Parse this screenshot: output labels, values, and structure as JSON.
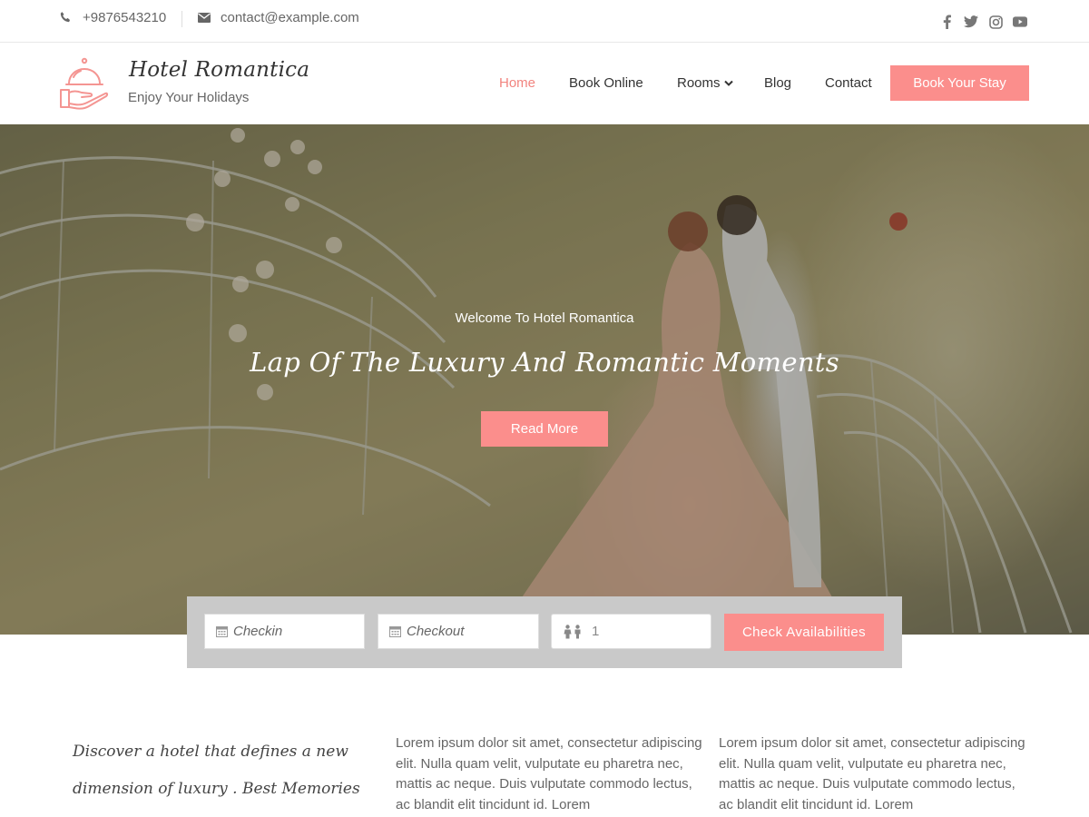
{
  "topbar": {
    "phone": "+9876543210",
    "email": "contact@example.com",
    "social": [
      "facebook-icon",
      "twitter-icon",
      "instagram-icon",
      "youtube-icon"
    ]
  },
  "brand": {
    "title": "Hotel Romantica",
    "tagline": "Enjoy Your Holidays"
  },
  "nav": {
    "items": [
      {
        "label": "Home",
        "active": true
      },
      {
        "label": "Book Online",
        "active": false
      },
      {
        "label": "Rooms",
        "active": false
      },
      {
        "label": "Blog",
        "active": false
      },
      {
        "label": "Contact",
        "active": false
      }
    ],
    "cta": "Book Your Stay"
  },
  "hero": {
    "subtitle": "Welcome To Hotel Romantica",
    "title": "Lap Of The Luxury And Romantic Moments",
    "button": "Read More"
  },
  "booking": {
    "checkin_placeholder": "Checkin",
    "checkout_placeholder": "Checkout",
    "guests": "1",
    "button": "Check Availabilities"
  },
  "content": {
    "intro": "Discover a hotel that defines a new dimension of luxury . Best Memories start here. Come In",
    "col1": "Lorem ipsum dolor sit amet, consectetur adipiscing elit. Nulla quam velit, vulputate eu pharetra nec, mattis ac neque. Duis vulputate commodo lectus, ac blandit elit tincidunt id. Lorem",
    "col2": "Lorem ipsum dolor sit amet, consectetur adipiscing elit. Nulla quam velit, vulputate eu pharetra nec, mattis ac neque. Duis vulputate commodo lectus, ac blandit elit tincidunt id. Lorem"
  },
  "colors": {
    "accent": "#fb8e8c",
    "nav_active": "#f2847f",
    "text": "#333333"
  }
}
